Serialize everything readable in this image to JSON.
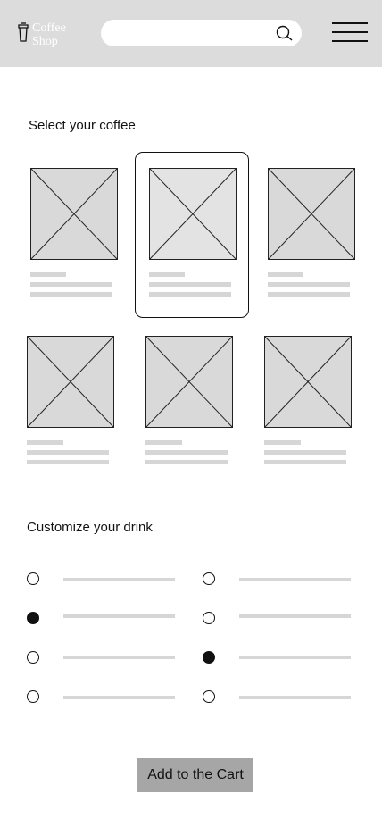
{
  "header": {
    "logo_line1": "Coffee",
    "logo_line2": "Shop",
    "search": {
      "placeholder": "",
      "icon": "search-icon"
    },
    "menu_icon": "hamburger-menu-icon"
  },
  "coffee_section": {
    "title": "Select your coffee",
    "items": [
      {
        "image": "image-placeholder",
        "selected": false
      },
      {
        "image": "image-placeholder",
        "selected": true
      },
      {
        "image": "image-placeholder",
        "selected": false
      },
      {
        "image": "image-placeholder",
        "selected": false
      },
      {
        "image": "image-placeholder",
        "selected": false
      },
      {
        "image": "image-placeholder",
        "selected": false
      }
    ]
  },
  "customize_section": {
    "title": "Customize your drink",
    "options_left": [
      {
        "checked": false
      },
      {
        "checked": true
      },
      {
        "checked": false
      },
      {
        "checked": false
      }
    ],
    "options_right": [
      {
        "checked": false
      },
      {
        "checked": false
      },
      {
        "checked": true
      },
      {
        "checked": false
      }
    ]
  },
  "cart_button_label": "Add to the Cart",
  "colors": {
    "header_bg": "#dcdcdc",
    "placeholder": "#d9d9d9",
    "button_bg": "#a6a6a6"
  }
}
